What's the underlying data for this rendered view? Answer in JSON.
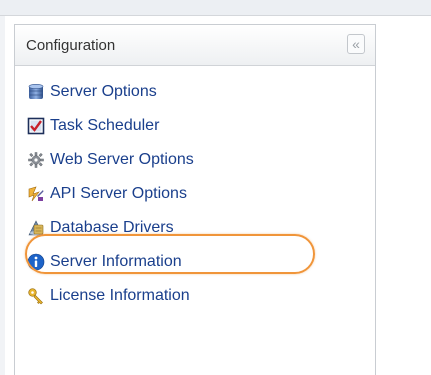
{
  "panel": {
    "title": "Configuration",
    "collapse_glyph": "«",
    "items": [
      {
        "label": "Server Options",
        "icon": "server-options-icon"
      },
      {
        "label": "Task Scheduler",
        "icon": "task-scheduler-icon"
      },
      {
        "label": "Web Server Options",
        "icon": "web-server-options-icon"
      },
      {
        "label": "API Server Options",
        "icon": "api-server-options-icon"
      },
      {
        "label": "Database Drivers",
        "icon": "database-drivers-icon",
        "highlighted": true
      },
      {
        "label": "Server Information",
        "icon": "server-information-icon"
      },
      {
        "label": "License Information",
        "icon": "license-information-icon"
      }
    ]
  },
  "colors": {
    "link_text": "#1a3f8c",
    "highlight": "#f0953a"
  }
}
